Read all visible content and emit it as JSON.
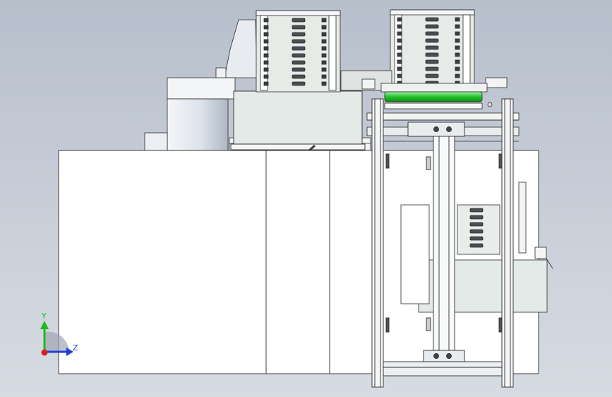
{
  "viewport": {
    "background_top": "#b7bfcc",
    "background_bottom": "#d7dbe2",
    "model_line_color": "#2a2a2a",
    "panel_fill": "#ffffff",
    "housing_fill": "#e4eae7",
    "highlight_roller_color": "#22c22a"
  },
  "triad": {
    "y_label": "Y",
    "z_label": "Z",
    "y_axis_color": "#1fb81f",
    "z_axis_color": "#1f3fd8",
    "x_axis_color": "#d81f1f"
  }
}
